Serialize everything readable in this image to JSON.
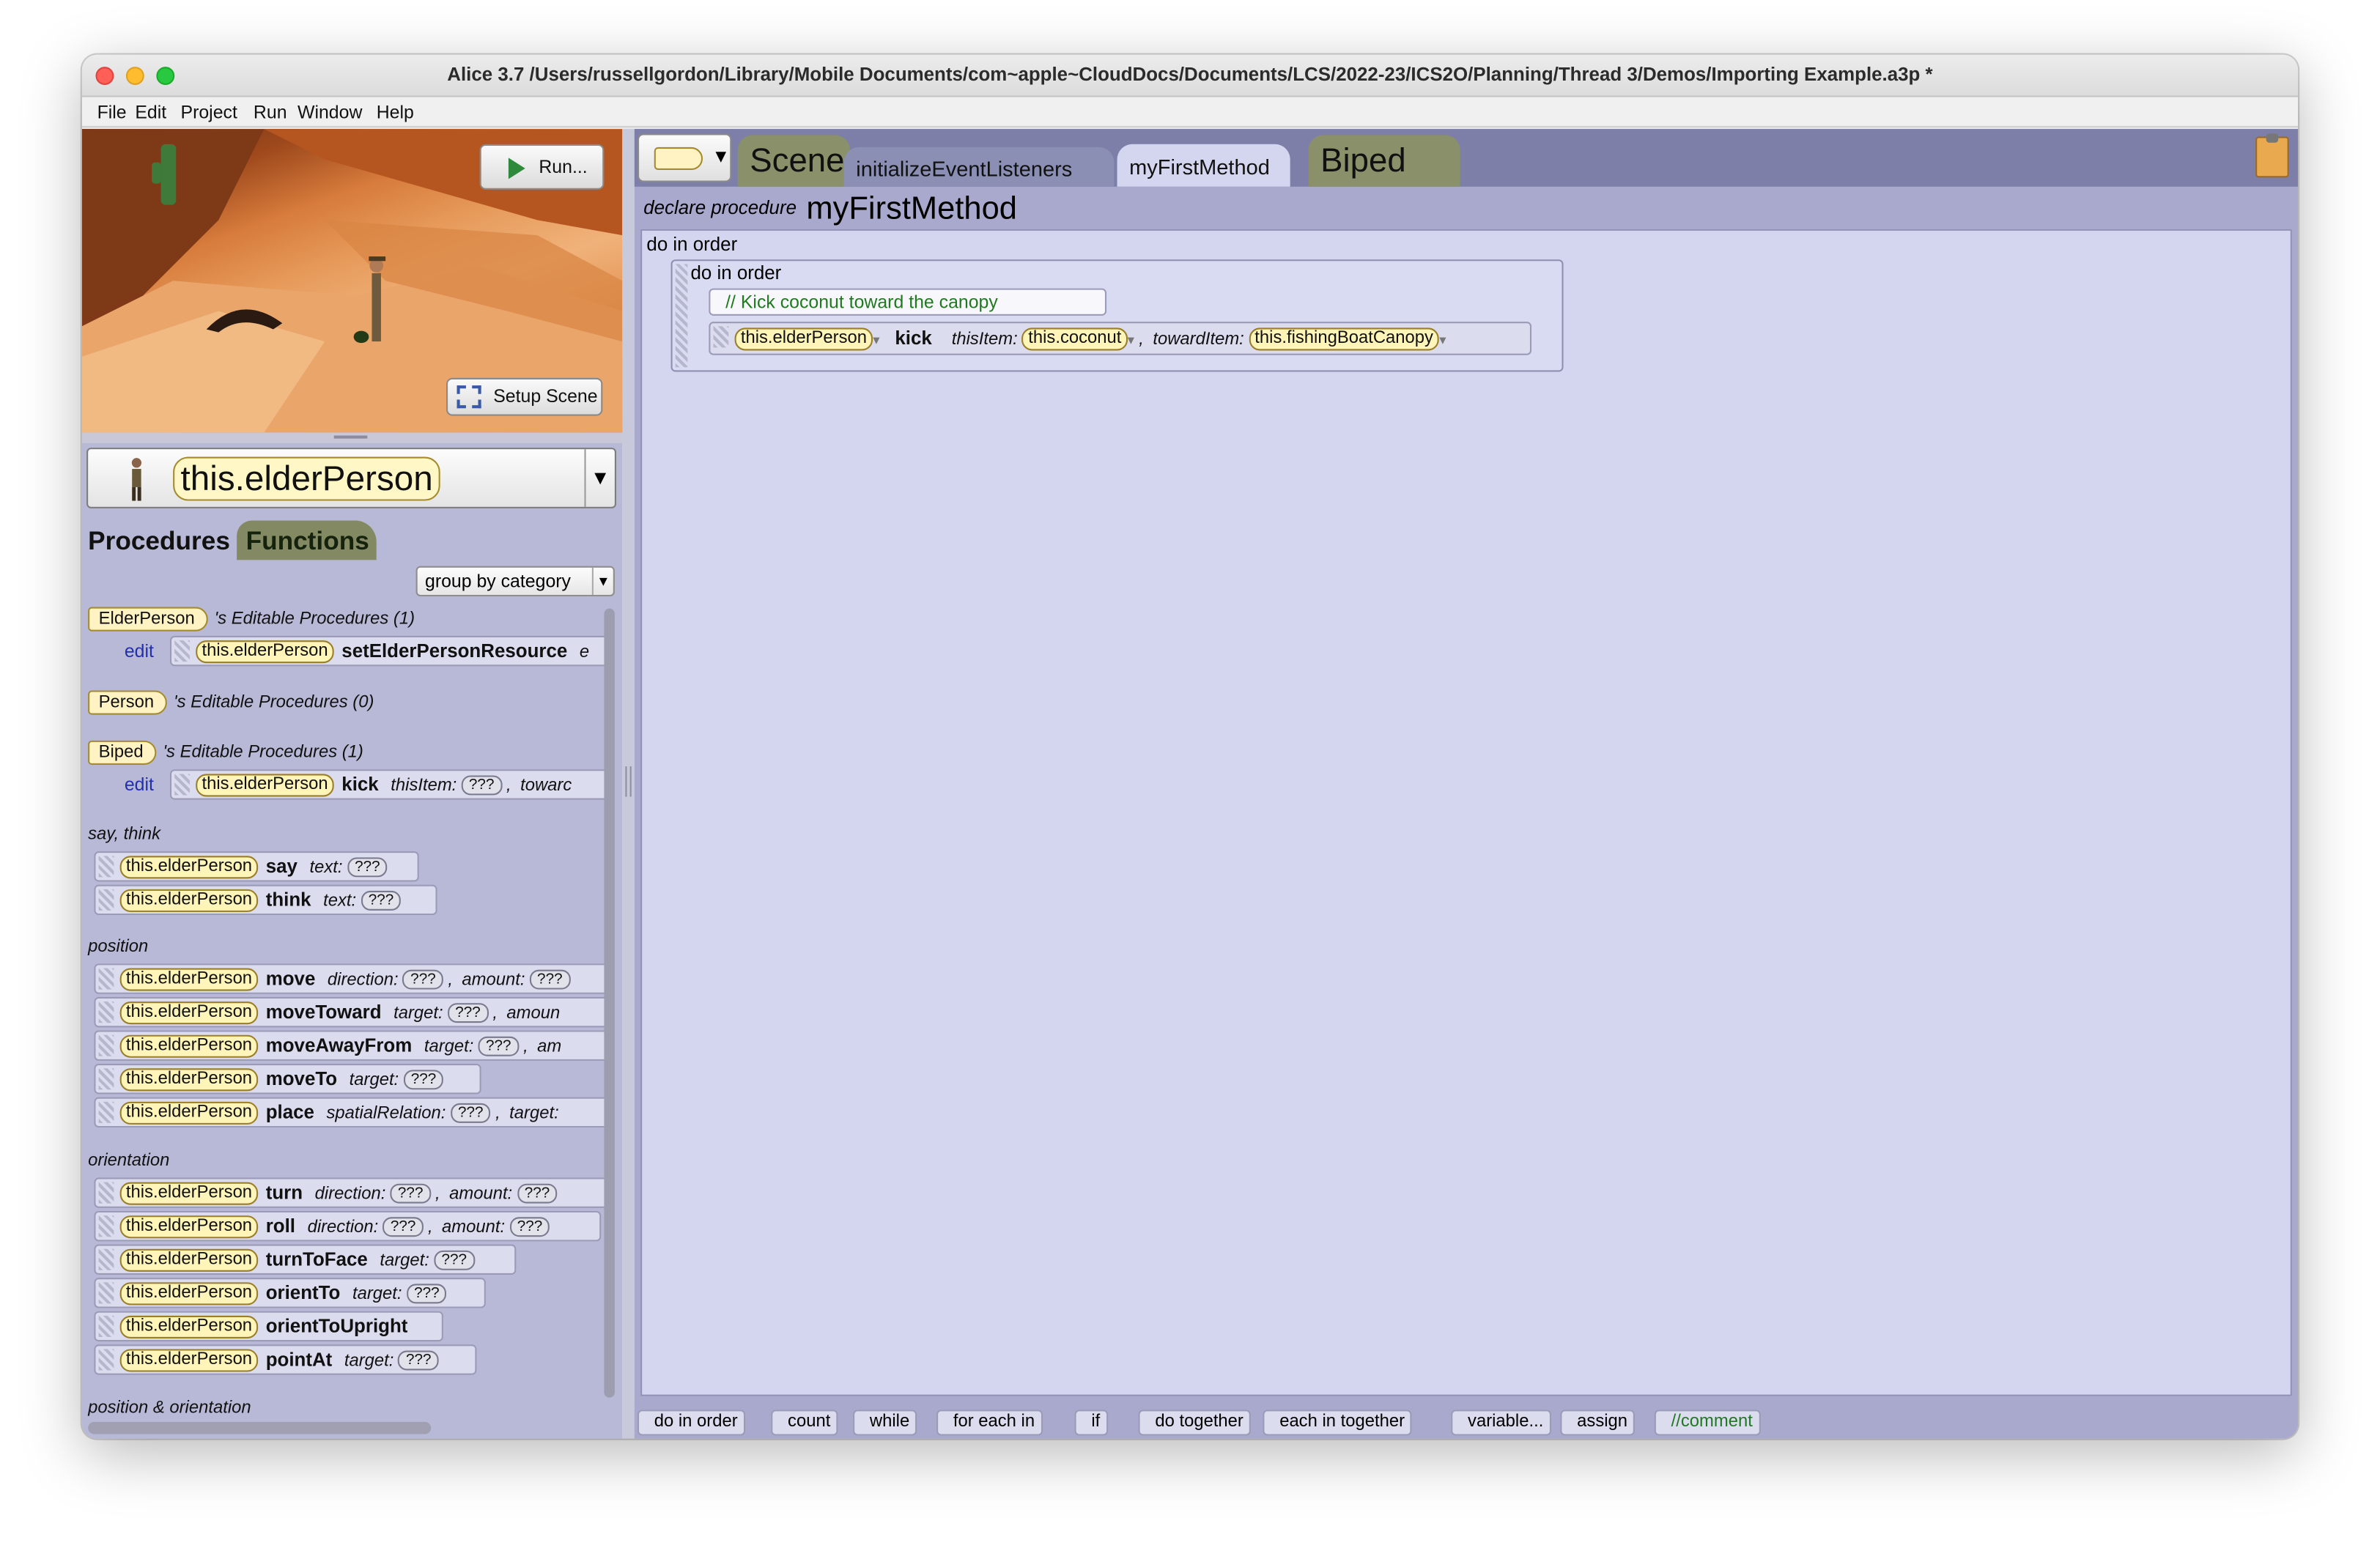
{
  "window": {
    "title": "Alice 3.7 /Users/russellgordon/Library/Mobile Documents/com~apple~CloudDocs/Documents/LCS/2022-23/ICS2O/Planning/Thread 3/Demos/Importing Example.a3p *"
  },
  "menu": [
    "File",
    "Edit",
    "Project",
    "Run",
    "Window",
    "Help"
  ],
  "scene_view": {
    "run_label": "Run...",
    "setup_label": "Setup Scene"
  },
  "selector": {
    "instance": "this.elderPerson"
  },
  "left_tabs": {
    "procedures": "Procedures",
    "functions": "Functions"
  },
  "group_select": {
    "value": "group by category"
  },
  "procedures": {
    "elder_class": "ElderPerson",
    "elder_header": "'s Editable Procedures (1)",
    "person_class": "Person",
    "person_header": "'s Editable Procedures (0)",
    "biped_class": "Biped",
    "biped_header": "'s Editable Procedures (1)",
    "edit_label": "edit",
    "this_label": "this.elderPerson",
    "setElder": "setElderPersonResource",
    "setElder_tail": "e",
    "kick": "kick",
    "thisItem": "thisItem:",
    "q": "???",
    "comma": ",",
    "toward_cut": "towarc",
    "cat_say": "say, think",
    "say": "say",
    "think": "think",
    "text": "text:",
    "cat_position": "position",
    "move": "move",
    "direction": "direction:",
    "amount": "amount:",
    "moveToward": "moveToward",
    "target": "target:",
    "amoun_cut": "amoun",
    "moveAwayFrom": "moveAwayFrom",
    "am_cut": "am",
    "moveTo": "moveTo",
    "place": "place",
    "spatialRelation": "spatialRelation:",
    "cat_orientation": "orientation",
    "turn": "turn",
    "roll": "roll",
    "turnToFace": "turnToFace",
    "orientTo": "orientTo",
    "orientToUpright": "orientToUpright",
    "pointAt": "pointAt",
    "cat_posor": "position & orientation"
  },
  "editor_tabs": {
    "scene": "Scene",
    "initialize": "initializeEventListeners",
    "myFirst": "myFirstMethod",
    "biped": "Biped"
  },
  "editor": {
    "declare": "declare procedure",
    "method": "myFirstMethod",
    "outer": "do in order",
    "inner": "do in order",
    "comment": "// Kick coconut toward the canopy",
    "target": "this.elderPerson",
    "proc": "kick",
    "p1": "thisItem:",
    "v1": "this.coconut",
    "comma": ",",
    "p2": "towardItem:",
    "v2": "this.fishingBoatCanopy"
  },
  "control_bar": [
    "do in order",
    "count",
    "while",
    "for each in",
    "if",
    "do together",
    "each in together",
    "variable...",
    "assign",
    "//comment"
  ]
}
